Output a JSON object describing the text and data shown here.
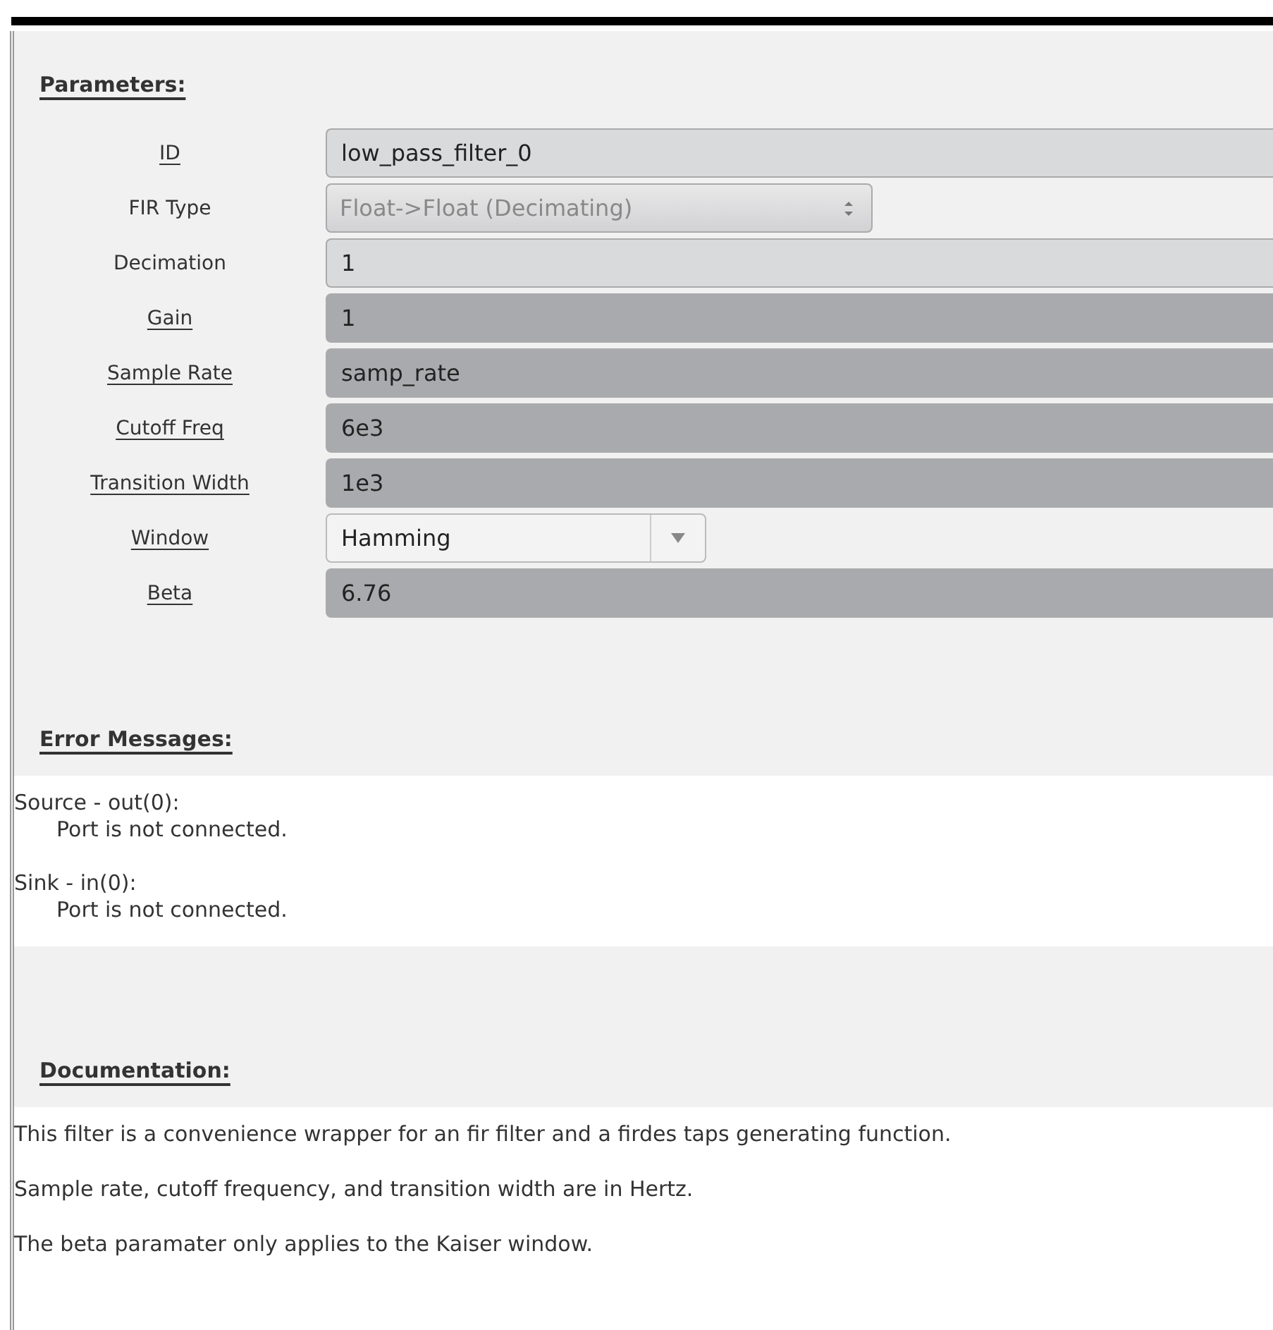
{
  "parameters": {
    "heading": "Parameters:",
    "rows": [
      {
        "label": "ID",
        "underlined": true,
        "kind": "entry",
        "value": "low_pass_filter_0",
        "color": "#d9dadc"
      },
      {
        "label": "FIR Type",
        "underlined": false,
        "kind": "spin-select",
        "value": "Float->Float (Decimating)"
      },
      {
        "label": "Decimation",
        "underlined": false,
        "kind": "entry",
        "value": "1",
        "color": "#d9dadc"
      },
      {
        "label": "Gain",
        "underlined": true,
        "kind": "entry",
        "value": "1",
        "color": "#a9aaad"
      },
      {
        "label": "Sample Rate",
        "underlined": true,
        "kind": "entry",
        "value": "samp_rate",
        "color": "#a9aaad"
      },
      {
        "label": "Cutoff Freq",
        "underlined": true,
        "kind": "entry",
        "value": "6e3",
        "color": "#a9aaad"
      },
      {
        "label": "Transition Width",
        "underlined": true,
        "kind": "entry",
        "value": "1e3",
        "color": "#a9aaad"
      },
      {
        "label": "Window",
        "underlined": true,
        "kind": "dropdown",
        "value": "Hamming"
      },
      {
        "label": "Beta",
        "underlined": true,
        "kind": "entry",
        "value": "6.76",
        "color": "#a9aaad"
      }
    ]
  },
  "error_messages": {
    "heading": "Error Messages:",
    "items": [
      {
        "source": "Source - out(0):",
        "message": "Port is not connected."
      },
      {
        "source": "Sink - in(0):",
        "message": "Port is not connected."
      }
    ]
  },
  "documentation": {
    "heading": "Documentation:",
    "paragraphs": [
      "This filter is a convenience wrapper for an fir filter and a firdes taps generating function.",
      "Sample rate, cutoff frequency, and transition width are in Hertz.",
      "The beta paramater only applies to the Kaiser window."
    ]
  }
}
